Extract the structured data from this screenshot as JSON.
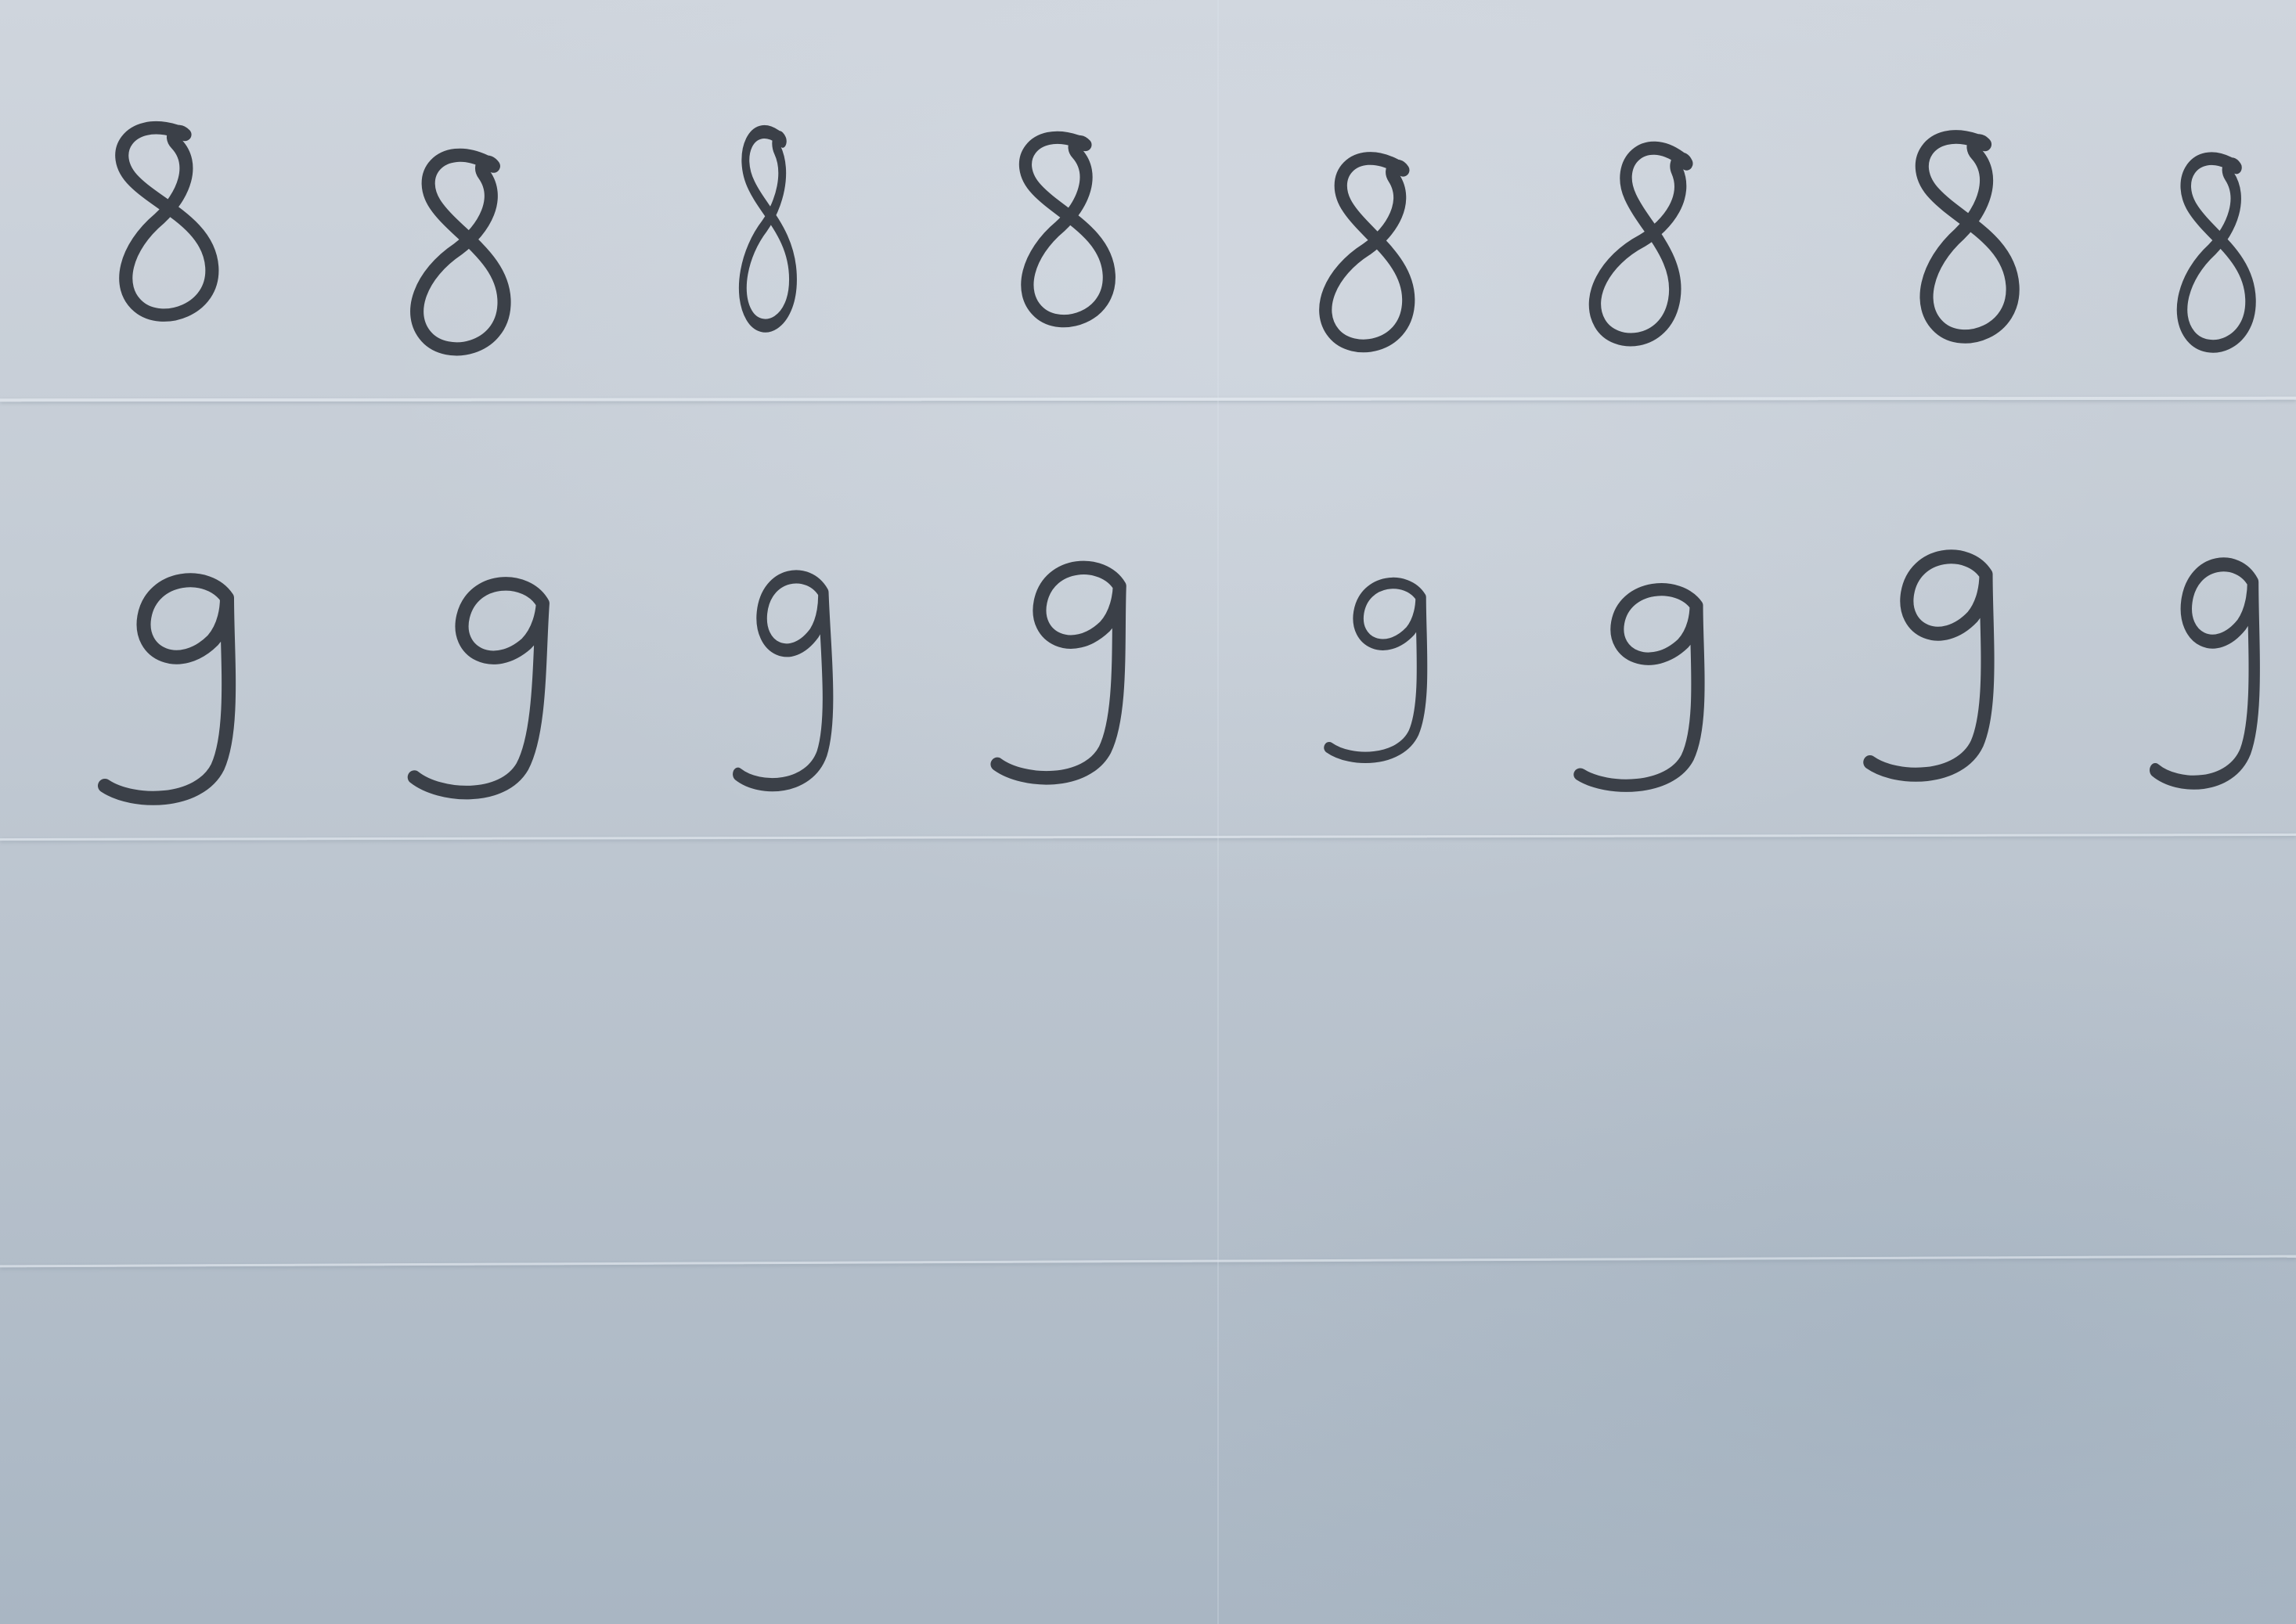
{
  "image": {
    "kind": "photo-of-handwritten-digits",
    "colors": {
      "paper": "#c4ccd5",
      "ink": "#3b4048"
    }
  },
  "rows": [
    {
      "digit": "8",
      "count": 8
    },
    {
      "digit": "9",
      "count": 8
    }
  ]
}
